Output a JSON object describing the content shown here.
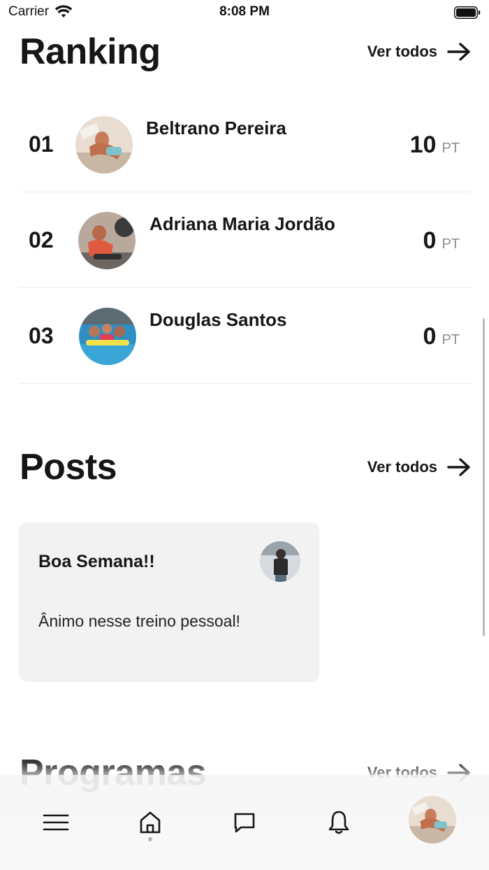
{
  "status_bar": {
    "carrier": "Carrier",
    "time": "8:08 PM"
  },
  "ranking": {
    "title": "Ranking",
    "see_all": "Ver todos",
    "items": [
      {
        "position": "01",
        "name": "Beltrano Pereira",
        "score": "10",
        "unit": "PT"
      },
      {
        "position": "02",
        "name": "Adriana Maria Jordão",
        "score": "0",
        "unit": "PT"
      },
      {
        "position": "03",
        "name": "Douglas Santos",
        "score": "0",
        "unit": "PT"
      }
    ]
  },
  "posts": {
    "title": "Posts",
    "see_all": "Ver todos",
    "items": [
      {
        "title": "Boa Semana!!",
        "body": "Ânimo nesse treino pessoal!"
      }
    ]
  },
  "programs": {
    "title": "Programas",
    "see_all": "Ver todos"
  },
  "tab_bar": {
    "tabs": [
      "menu-icon",
      "home-icon",
      "chat-icon",
      "bell-icon",
      "profile-avatar"
    ],
    "active": "home-icon"
  },
  "colors": {
    "text": "#161616",
    "card": "#f2f2f2",
    "muted": "#8e8e8e"
  }
}
